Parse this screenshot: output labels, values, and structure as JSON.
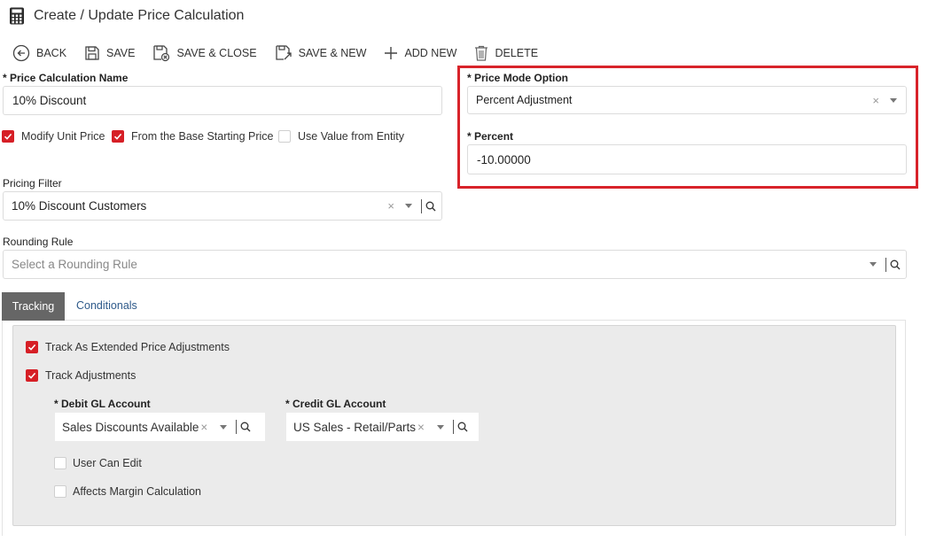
{
  "header": {
    "title": "Create / Update Price Calculation",
    "icon": "calculator-icon"
  },
  "toolbar": {
    "back": "BACK",
    "save": "SAVE",
    "save_close": "SAVE & CLOSE",
    "save_new": "SAVE & NEW",
    "add_new": "ADD NEW",
    "delete": "DELETE"
  },
  "form": {
    "price_calc_name_label": "* Price Calculation Name",
    "price_calc_name_value": "10% Discount",
    "modify_unit_price": {
      "label": "Modify Unit Price",
      "checked": true
    },
    "from_base_price": {
      "label": "From the Base Starting Price",
      "checked": true
    },
    "use_value_entity": {
      "label": "Use Value from Entity",
      "checked": false
    },
    "pricing_filter_label": "Pricing Filter",
    "pricing_filter_value": "10% Discount Customers",
    "rounding_rule_label": "Rounding Rule",
    "rounding_rule_placeholder": "Select a Rounding Rule",
    "price_mode_label": "* Price Mode Option",
    "price_mode_value": "Percent Adjustment",
    "percent_label": "* Percent",
    "percent_value": "-10.00000"
  },
  "tabs": {
    "tracking": "Tracking",
    "conditionals": "Conditionals"
  },
  "tracking": {
    "track_extended": {
      "label": "Track As Extended Price Adjustments",
      "checked": true
    },
    "track_adjustments": {
      "label": "Track Adjustments",
      "checked": true
    },
    "debit_label": "* Debit GL Account",
    "debit_value": "Sales Discounts Available",
    "credit_label": "* Credit GL Account",
    "credit_value": "US Sales - Retail/Parts",
    "user_can_edit": {
      "label": "User Can Edit",
      "checked": false
    },
    "affects_margin": {
      "label": "Affects Margin Calculation",
      "checked": false
    }
  },
  "colors": {
    "accent_red": "#d61f26",
    "highlight_border": "#d8232a",
    "tab_active_bg": "#666666",
    "tab_link": "#2e5a8a",
    "panel_bg": "#ebebeb"
  }
}
